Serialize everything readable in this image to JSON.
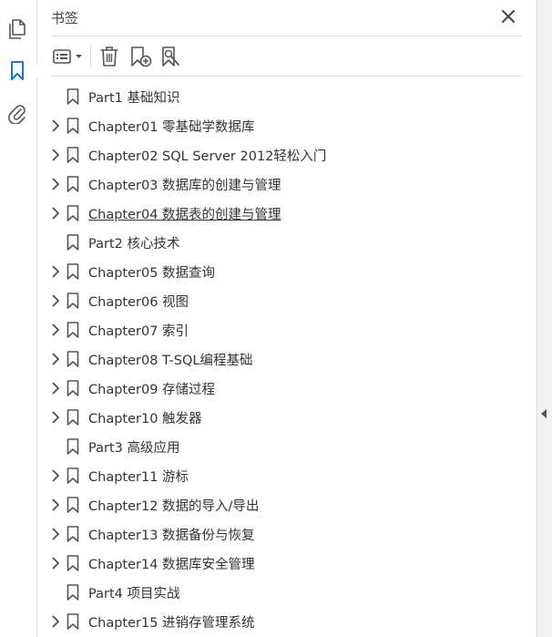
{
  "rail": {
    "items": [
      {
        "name": "pages-icon"
      },
      {
        "name": "bookmark-icon"
      },
      {
        "name": "attachment-icon"
      }
    ]
  },
  "panel": {
    "title": "书签",
    "close_icon": "close-icon"
  },
  "toolbar": {
    "buttons": [
      {
        "name": "options-menu-icon"
      },
      {
        "name": "delete-bookmark-icon"
      },
      {
        "name": "new-bookmark-icon"
      },
      {
        "name": "find-bookmark-icon"
      }
    ]
  },
  "bookmarks": [
    {
      "label": "Part1 基础知识",
      "expandable": false
    },
    {
      "label": "Chapter01 零基础学数据库",
      "expandable": true
    },
    {
      "label": "Chapter02 SQL Server 2012轻松入门",
      "expandable": true
    },
    {
      "label": "Chapter03 数据库的创建与管理",
      "expandable": true
    },
    {
      "label": "Chapter04 数据表的创建与管理",
      "expandable": true,
      "underlined": true
    },
    {
      "label": "Part2 核心技术",
      "expandable": false
    },
    {
      "label": "Chapter05 数据查询",
      "expandable": true
    },
    {
      "label": "Chapter06 视图",
      "expandable": true
    },
    {
      "label": "Chapter07 索引",
      "expandable": true
    },
    {
      "label": "Chapter08 T-SQL编程基础",
      "expandable": true
    },
    {
      "label": "Chapter09 存储过程",
      "expandable": true
    },
    {
      "label": "Chapter10 触发器",
      "expandable": true
    },
    {
      "label": "Part3 高级应用",
      "expandable": false
    },
    {
      "label": "Chapter11 游标",
      "expandable": true
    },
    {
      "label": "Chapter12 数据的导入/导出",
      "expandable": true
    },
    {
      "label": "Chapter13 数据备份与恢复",
      "expandable": true
    },
    {
      "label": "Chapter14 数据库安全管理",
      "expandable": true
    },
    {
      "label": "Part4 项目实战",
      "expandable": false
    },
    {
      "label": "Chapter15 进销存管理系统",
      "expandable": true
    }
  ],
  "colors": {
    "icon": "#555555",
    "active_icon": "#1473e6",
    "text": "#333333"
  }
}
